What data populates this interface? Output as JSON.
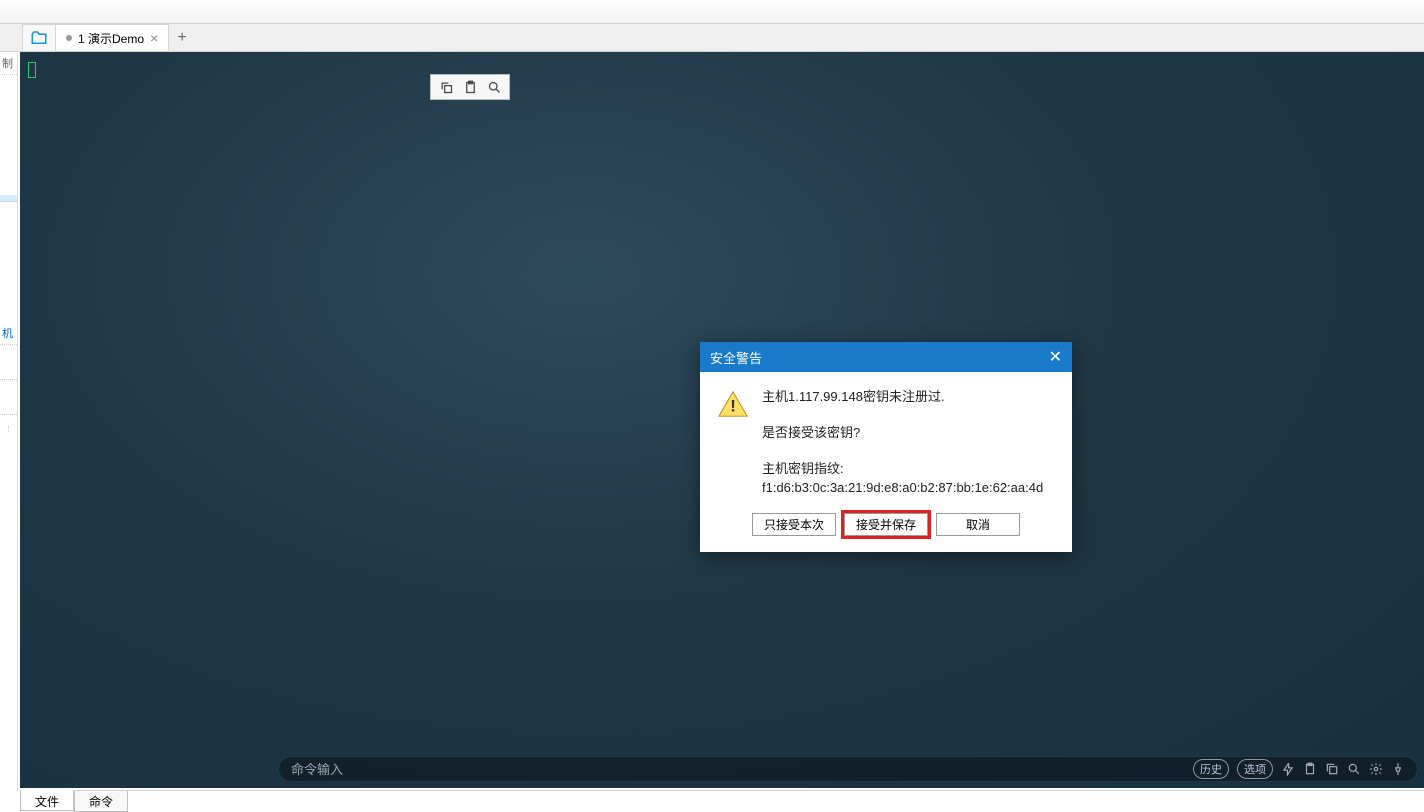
{
  "tab_strip": {
    "tab_label": "1 演示Demo",
    "tab_dirty": true
  },
  "sidebar": {
    "top_label": "制",
    "active_label": "机"
  },
  "dialog": {
    "title": "安全警告",
    "line1": "主机1.117.99.148密钥未注册过.",
    "line2": "是否接受该密钥?",
    "line3_label": "主机密钥指纹:",
    "fingerprint": "f1:d6:b3:0c:3a:21:9d:e8:a0:b2:87:bb:1e:62:aa:4d",
    "btn_accept_once": "只接受本次",
    "btn_accept_save": "接受并保存",
    "btn_cancel": "取消"
  },
  "command_bar": {
    "placeholder": "命令输入",
    "history_label": "历史",
    "options_label": "选项"
  },
  "bottom_tabs": {
    "file": "文件",
    "command": "命令"
  }
}
